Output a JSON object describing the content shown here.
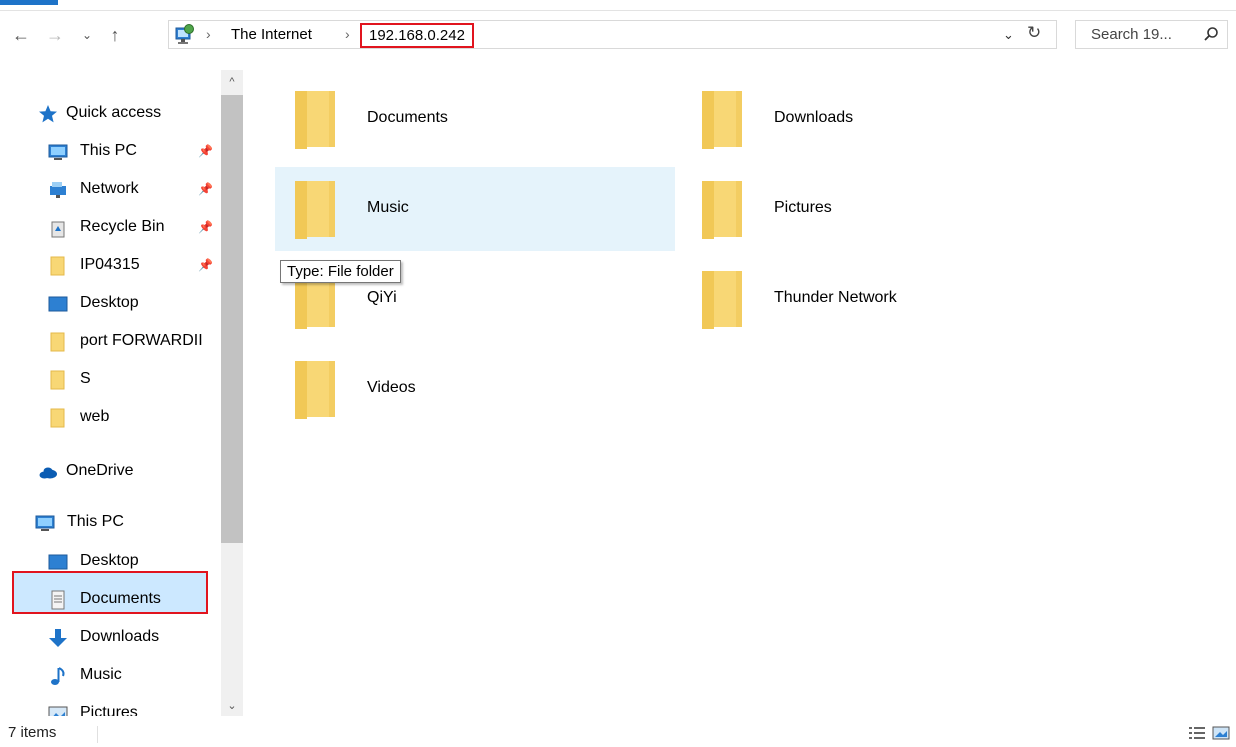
{
  "address_bar": {
    "crumbs": [
      "The Internet",
      "192.168.0.242"
    ],
    "search_placeholder": "Search 19..."
  },
  "sidebar": {
    "quick_access": "Quick access",
    "items": [
      {
        "label": "This PC",
        "icon": "monitor-icon",
        "pinned": true
      },
      {
        "label": "Network",
        "icon": "network-icon",
        "pinned": true
      },
      {
        "label": "Recycle Bin",
        "icon": "recycle-bin-icon",
        "pinned": true
      },
      {
        "label": "IP04315",
        "icon": "folder-icon",
        "pinned": true
      },
      {
        "label": "Desktop",
        "icon": "desktop-icon",
        "pinned": false
      },
      {
        "label": "port FORWARDII",
        "icon": "folder-icon",
        "pinned": false
      },
      {
        "label": "S",
        "icon": "folder-icon",
        "pinned": false
      },
      {
        "label": "web",
        "icon": "folder-icon",
        "pinned": false
      }
    ],
    "onedrive": "OneDrive",
    "this_pc": "This PC",
    "this_pc_children": [
      {
        "label": "Desktop",
        "icon": "desktop-icon"
      },
      {
        "label": "Documents",
        "icon": "documents-icon"
      },
      {
        "label": "Downloads",
        "icon": "downloads-icon"
      },
      {
        "label": "Music",
        "icon": "music-icon"
      },
      {
        "label": "Pictures",
        "icon": "pictures-icon"
      }
    ]
  },
  "folders": [
    {
      "name": "Documents"
    },
    {
      "name": "Downloads"
    },
    {
      "name": "Music"
    },
    {
      "name": "Pictures"
    },
    {
      "name": "QiYi"
    },
    {
      "name": "Thunder Network"
    },
    {
      "name": "Videos"
    }
  ],
  "tooltip": "Type: File folder",
  "status": {
    "count": "7 items"
  },
  "colors": {
    "accent": "#1e73c8",
    "highlight": "#e1141e",
    "hover": "#e5f3fb",
    "folder": "#f8d775"
  }
}
